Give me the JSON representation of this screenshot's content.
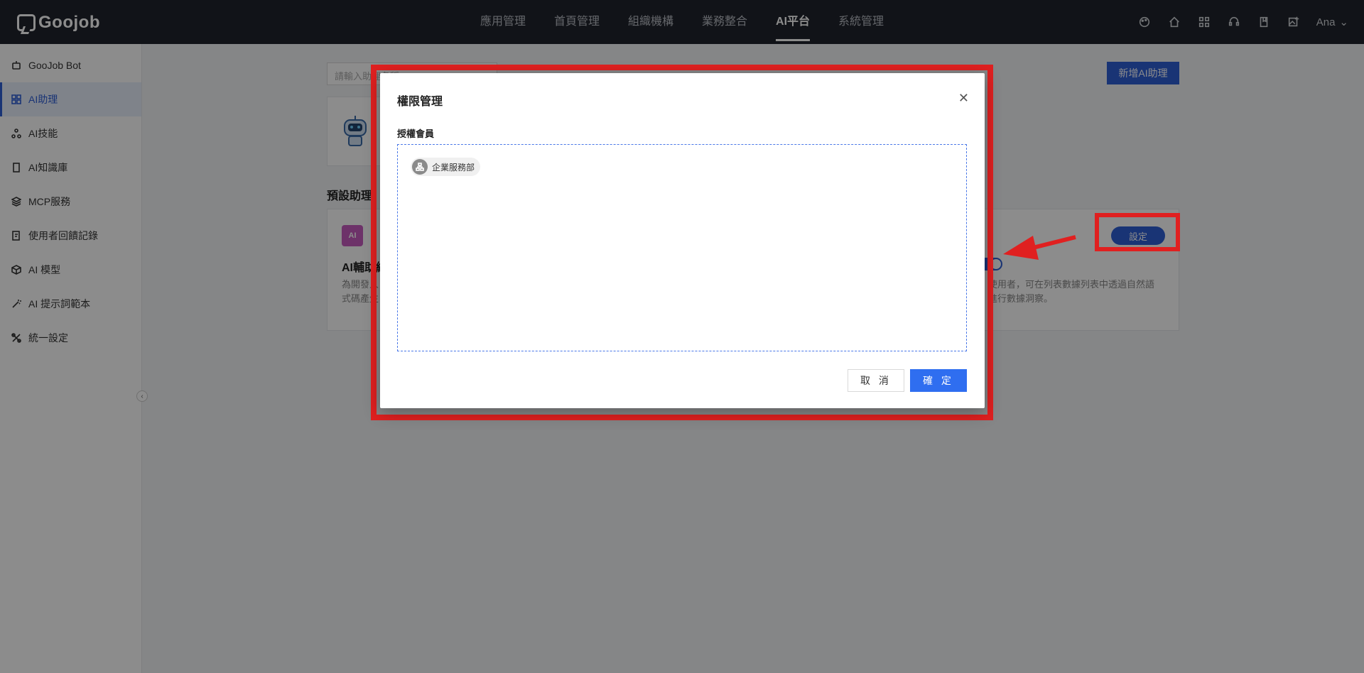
{
  "brand": {
    "logo_text": "Goojob"
  },
  "top_nav": {
    "items": [
      {
        "label": "應用管理"
      },
      {
        "label": "首頁管理"
      },
      {
        "label": "組織機構"
      },
      {
        "label": "業務整合"
      },
      {
        "label": "AI平台"
      },
      {
        "label": "系統管理"
      }
    ],
    "active_index": 4,
    "user": "Ana"
  },
  "sidebar": {
    "items": [
      {
        "label": "GooJob Bot",
        "icon": "robot-icon"
      },
      {
        "label": "AI助理",
        "icon": "grid-icon"
      },
      {
        "label": "AI技能",
        "icon": "nodes-icon"
      },
      {
        "label": "AI知識庫",
        "icon": "book-icon"
      },
      {
        "label": "MCP服務",
        "icon": "layers-icon"
      },
      {
        "label": "使用者回饋記錄",
        "icon": "edit-doc-icon"
      },
      {
        "label": "AI 模型",
        "icon": "cube-icon"
      },
      {
        "label": "AI 提示詞範本",
        "icon": "wand-icon"
      },
      {
        "label": "統一設定",
        "icon": "tools-icon"
      }
    ],
    "active_index": 1
  },
  "main": {
    "search_placeholder": "請輸入助理名稱",
    "add_button": "新增AI助理",
    "section_title": "預設助理",
    "skill": {
      "icon_text": "AI",
      "name": "AI輔助繪",
      "desc_left": "為開發人\n式碼產生",
      "desc_right": "使用者，可在列表數據列表中透過自然語\n進行數據洞察。",
      "setting_button": "設定"
    }
  },
  "modal": {
    "title": "權限管理",
    "field_label": "授權會員",
    "members": [
      {
        "name": "企業服務部",
        "icon": "org-chart-icon"
      }
    ],
    "cancel": "取 消",
    "ok": "確 定"
  },
  "colors": {
    "topbar": "#20242c",
    "primary": "#2f5fd6",
    "annotation": "#e02020"
  }
}
